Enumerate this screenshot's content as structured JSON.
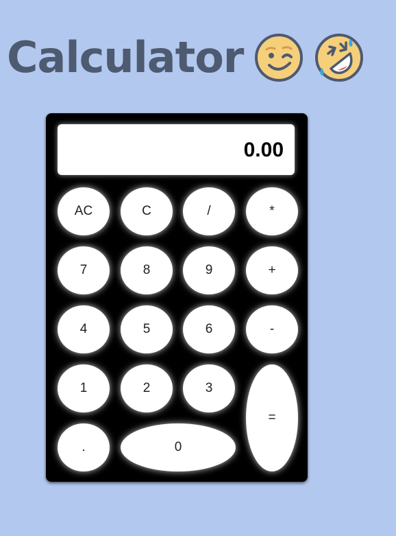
{
  "header": {
    "title": "Calculator",
    "emojis": [
      "winking-face-icon",
      "rolling-on-floor-laughing-icon"
    ]
  },
  "calculator": {
    "display_value": "0.00",
    "keys": {
      "all_clear": "AC",
      "clear": "C",
      "divide": "/",
      "multiply": "*",
      "seven": "7",
      "eight": "8",
      "nine": "9",
      "plus": "+",
      "four": "4",
      "five": "5",
      "six": "6",
      "minus": "-",
      "one": "1",
      "two": "2",
      "three": "3",
      "equals": "=",
      "decimal": ".",
      "zero": "0"
    }
  },
  "colors": {
    "background": "#b3c8ef",
    "title": "#4d5a70",
    "calculator_body": "#000000",
    "key": "#ffffff",
    "emoji_face": "#f5cf7a",
    "emoji_outline": "#4d5a70",
    "tears": "#3aa8e0"
  }
}
